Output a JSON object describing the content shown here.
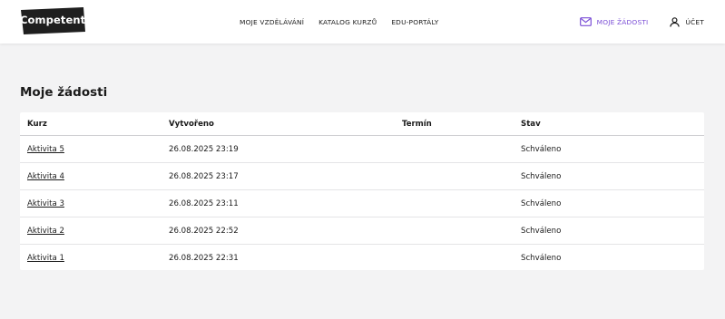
{
  "header": {
    "logo_text": "Competent",
    "nav": [
      {
        "label": "MOJE VZDĚLÁVÁNÍ"
      },
      {
        "label": "KATALOG KURZŮ"
      },
      {
        "label": "EDU-PORTÁLY"
      }
    ],
    "requests_label": "MOJE ŽÁDOSTI",
    "account_label": "ÚČET",
    "requests_icon": "mail-icon",
    "account_icon": "user-icon"
  },
  "colors": {
    "accent": "#7b4fd6",
    "logo_bg": "#1f1f1f",
    "page_bg": "#f3f3f4"
  },
  "main": {
    "title": "Moje žádosti",
    "table": {
      "headers": [
        "Kurz",
        "Vytvořeno",
        "Termín",
        "Stav"
      ],
      "rows": [
        {
          "course": "Aktivita 5",
          "created": "26.08.2025 23:19",
          "term": "",
          "status": "Schváleno"
        },
        {
          "course": "Aktivita 4",
          "created": "26.08.2025 23:17",
          "term": "",
          "status": "Schváleno"
        },
        {
          "course": "Aktivita 3",
          "created": "26.08.2025 23:11",
          "term": "",
          "status": "Schváleno"
        },
        {
          "course": "Aktivita 2",
          "created": "26.08.2025 22:52",
          "term": "",
          "status": "Schváleno"
        },
        {
          "course": "Aktivita 1",
          "created": "26.08.2025 22:31",
          "term": "",
          "status": "Schváleno"
        }
      ]
    }
  }
}
